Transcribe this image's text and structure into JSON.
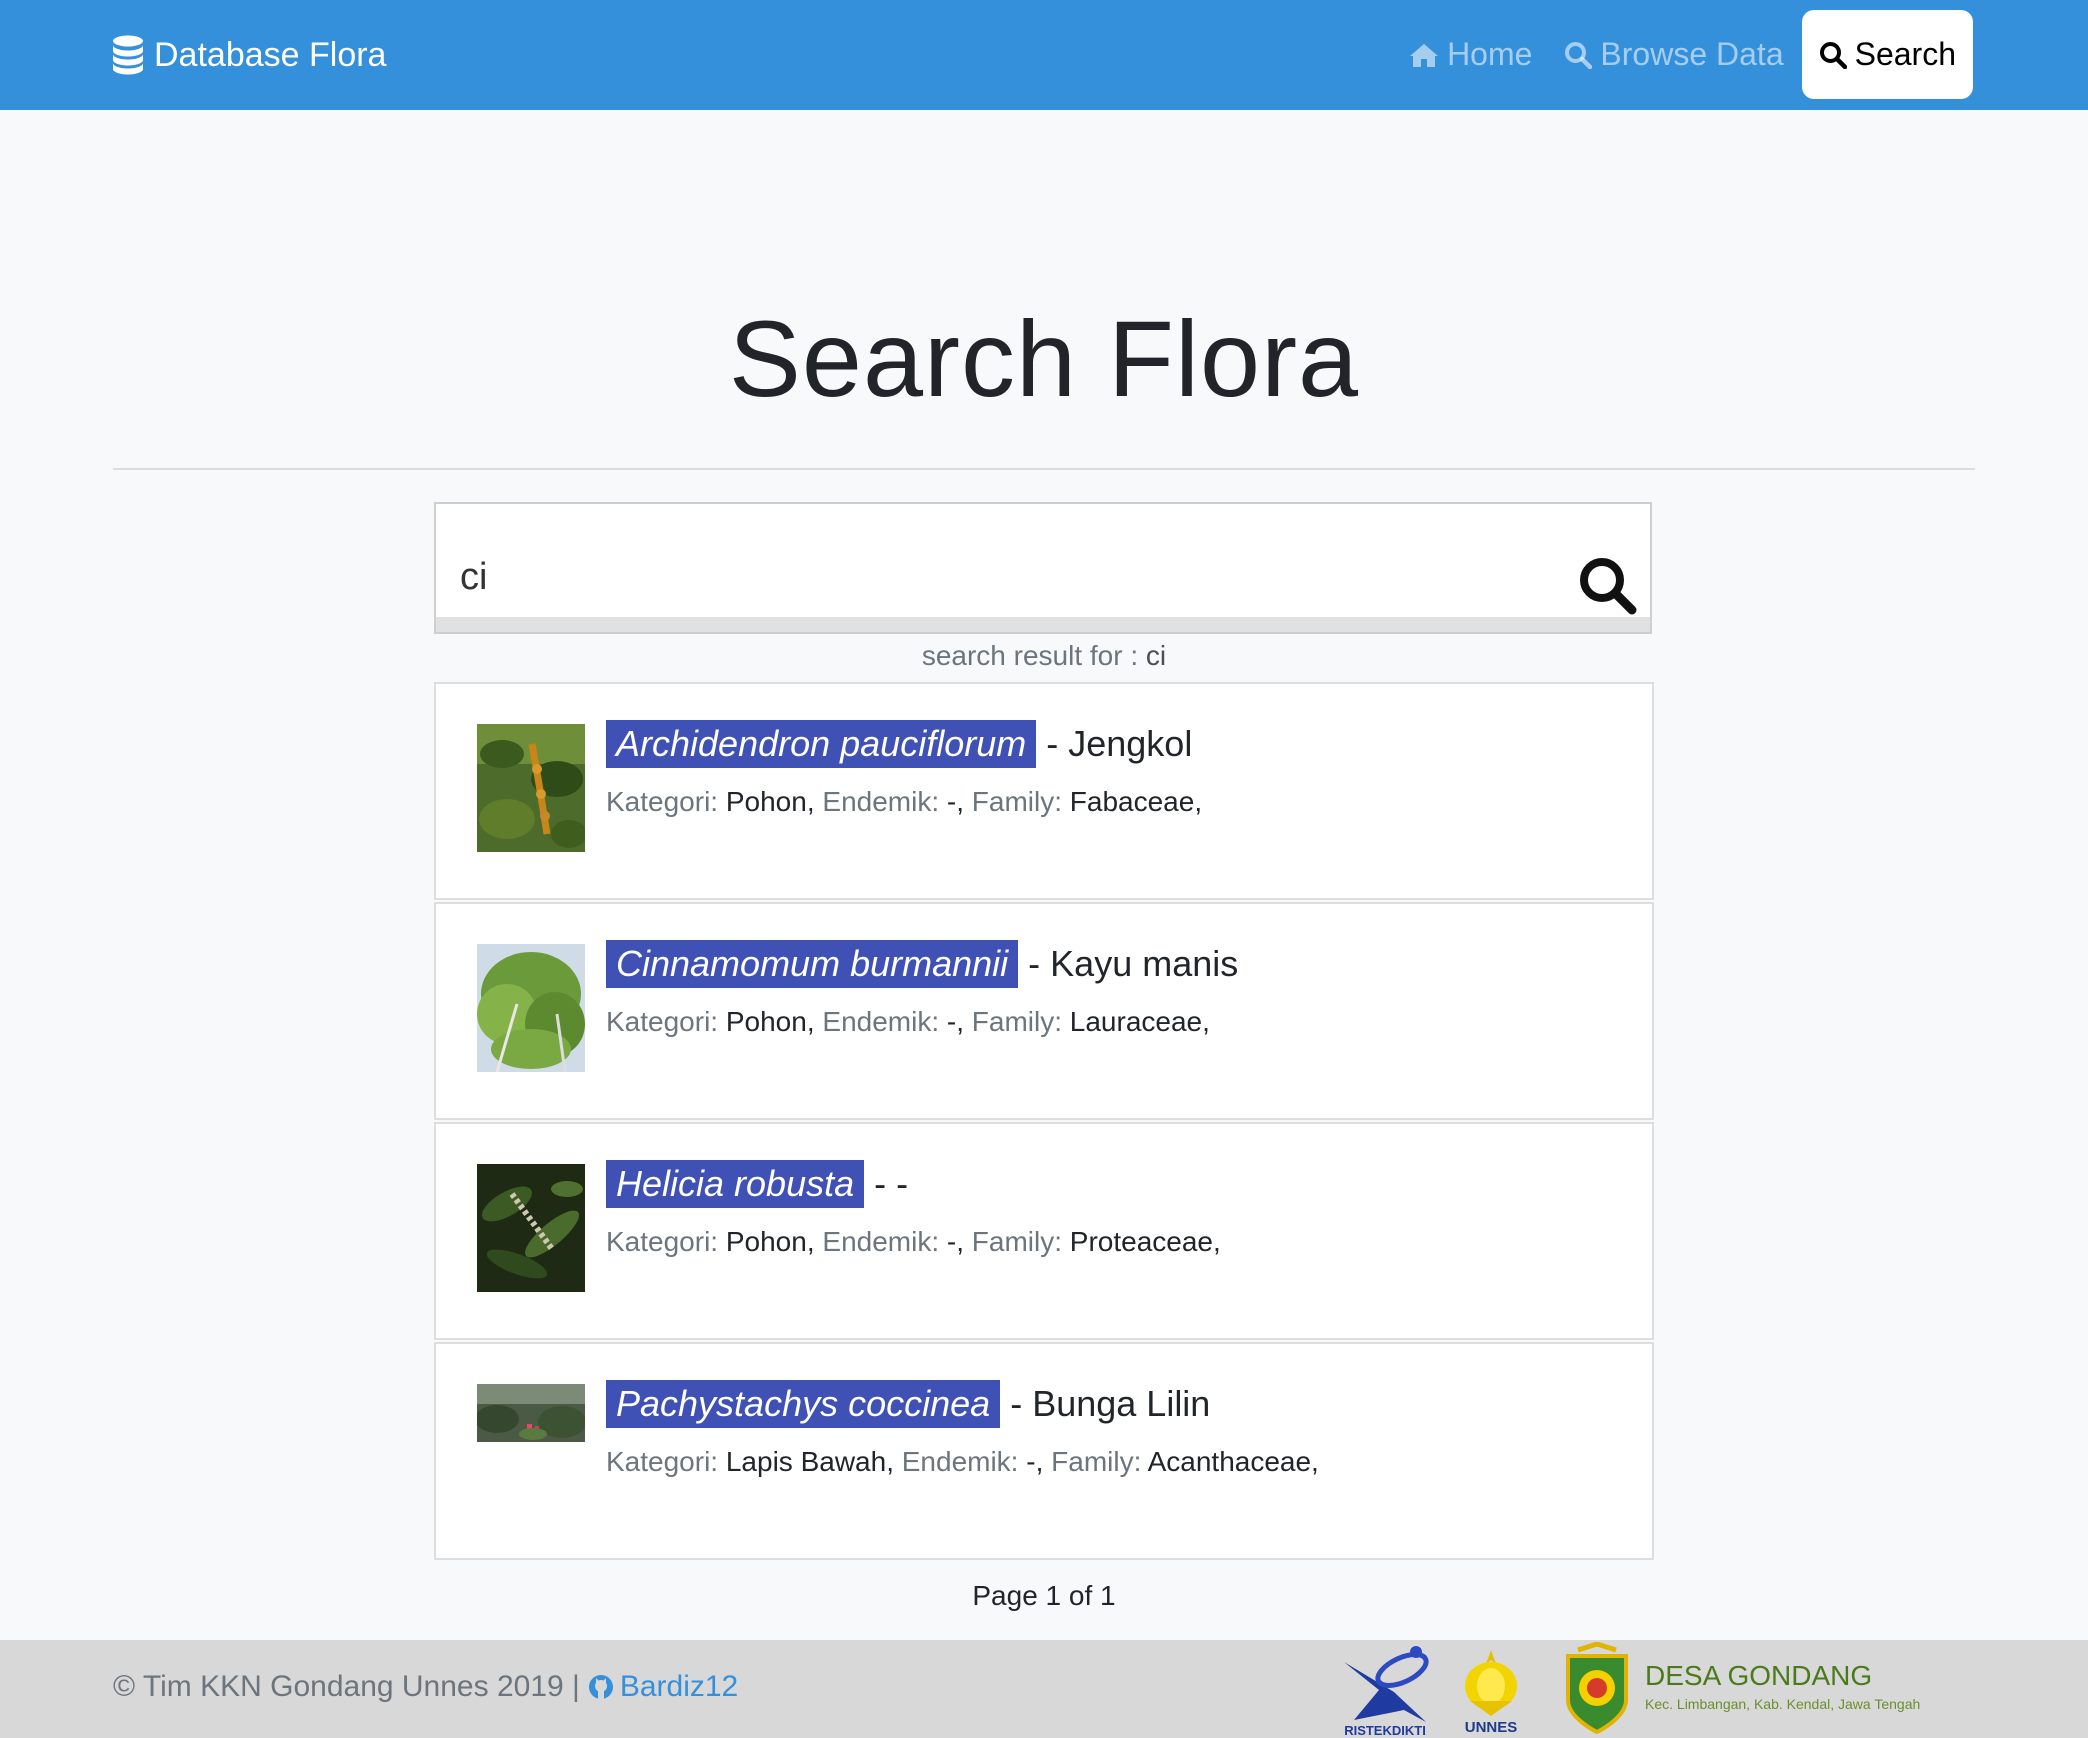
{
  "navbar": {
    "brand": "Database Flora",
    "links": [
      {
        "label": "Home",
        "icon": "home-icon",
        "active": false
      },
      {
        "label": "Browse Data",
        "icon": "search-icon",
        "active": false
      },
      {
        "label": "Search",
        "icon": "search-icon",
        "active": true
      }
    ],
    "color": "#3590dc"
  },
  "page": {
    "title": "Search Flora"
  },
  "search": {
    "value": "ci",
    "result_prefix": "search result for : ",
    "result_query": "ci"
  },
  "results": [
    {
      "scientific_name": "Archidendron pauciflorum",
      "local_name": "- Jengkol",
      "kategori": "Pohon,",
      "endemik": "-,",
      "family": "Fabaceae,"
    },
    {
      "scientific_name": "Cinnamomum burmannii",
      "local_name": "- Kayu manis",
      "kategori": "Pohon,",
      "endemik": "-,",
      "family": "Lauraceae,"
    },
    {
      "scientific_name": "Helicia robusta",
      "local_name": "- -",
      "kategori": "Pohon,",
      "endemik": "-,",
      "family": "Proteaceae,"
    },
    {
      "scientific_name": "Pachystachys coccinea",
      "local_name": "- Bunga Lilin",
      "kategori": "Lapis Bawah,",
      "endemik": "-,",
      "family": "Acanthaceae,"
    }
  ],
  "labels": {
    "kategori": "Kategori: ",
    "endemik": " Endemik: ",
    "family": " Family: "
  },
  "pagination": "Page 1 of 1",
  "footer": {
    "copyright": "© Tim KKN Gondang Unnes 2019 |",
    "github_user": "Bardiz12",
    "logo_ristek": "RISTEKDIKTI",
    "logo_unnes": "UNNES",
    "desa_name": "DESA GONDANG",
    "desa_sub": "Kec. Limbangan, Kab. Kendal, Jawa Tengah"
  },
  "colors": {
    "highlight": "#3f51b5",
    "accent": "#3590dc"
  }
}
